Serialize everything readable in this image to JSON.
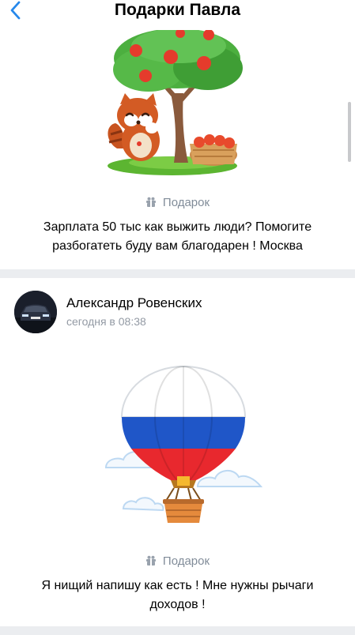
{
  "header": {
    "title": "Подарки Павла"
  },
  "items": [
    {
      "gift_label": "Подарок",
      "message": "Зарплата 50 тыс как выжить люди? Помогите разбогатеть буду вам благодарен ! Москва"
    },
    {
      "author": "Александр Ровенских",
      "time": "сегодня в 08:38",
      "gift_label": "Подарок",
      "message": "Я нищий напишу как есть ! Мне нужны рычаги доходов !"
    }
  ],
  "colors": {
    "accent": "#2688eb",
    "secondary_text": "#818c99",
    "separator": "#ebedf0"
  },
  "icons": {
    "back": "chevron-left-icon",
    "gift": "gift-icon"
  }
}
